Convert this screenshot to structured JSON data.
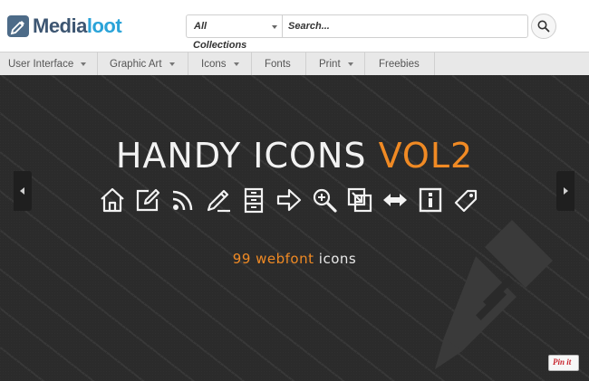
{
  "brand": {
    "name_part1": "Media",
    "name_part2": "loot"
  },
  "search": {
    "category_value": "All",
    "category_sub": "Collections",
    "placeholder": "Search..."
  },
  "nav": {
    "items": [
      {
        "label": "User Interface"
      },
      {
        "label": "Graphic Art"
      },
      {
        "label": "Icons"
      },
      {
        "label": "Fonts"
      },
      {
        "label": "Print"
      },
      {
        "label": "Freebies"
      }
    ]
  },
  "hero": {
    "title_main": "HANDY ICONS ",
    "title_accent": "VOL2",
    "subtitle_accent": "99 webfont",
    "subtitle_rest": " icons",
    "icons": [
      "home-icon",
      "edit-icon",
      "rss-icon",
      "pencil-icon",
      "cabinet-icon",
      "arrow-right-icon",
      "zoom-in-icon",
      "external-link-icon",
      "resize-horizontal-icon",
      "info-icon",
      "tag-icon"
    ]
  },
  "pinit": {
    "label": "Pin it"
  },
  "colors": {
    "accent": "#f08a24",
    "brand_dark": "#3d5672",
    "brand_light": "#2aa3d8",
    "hero_bg": "#2a2a2a"
  }
}
